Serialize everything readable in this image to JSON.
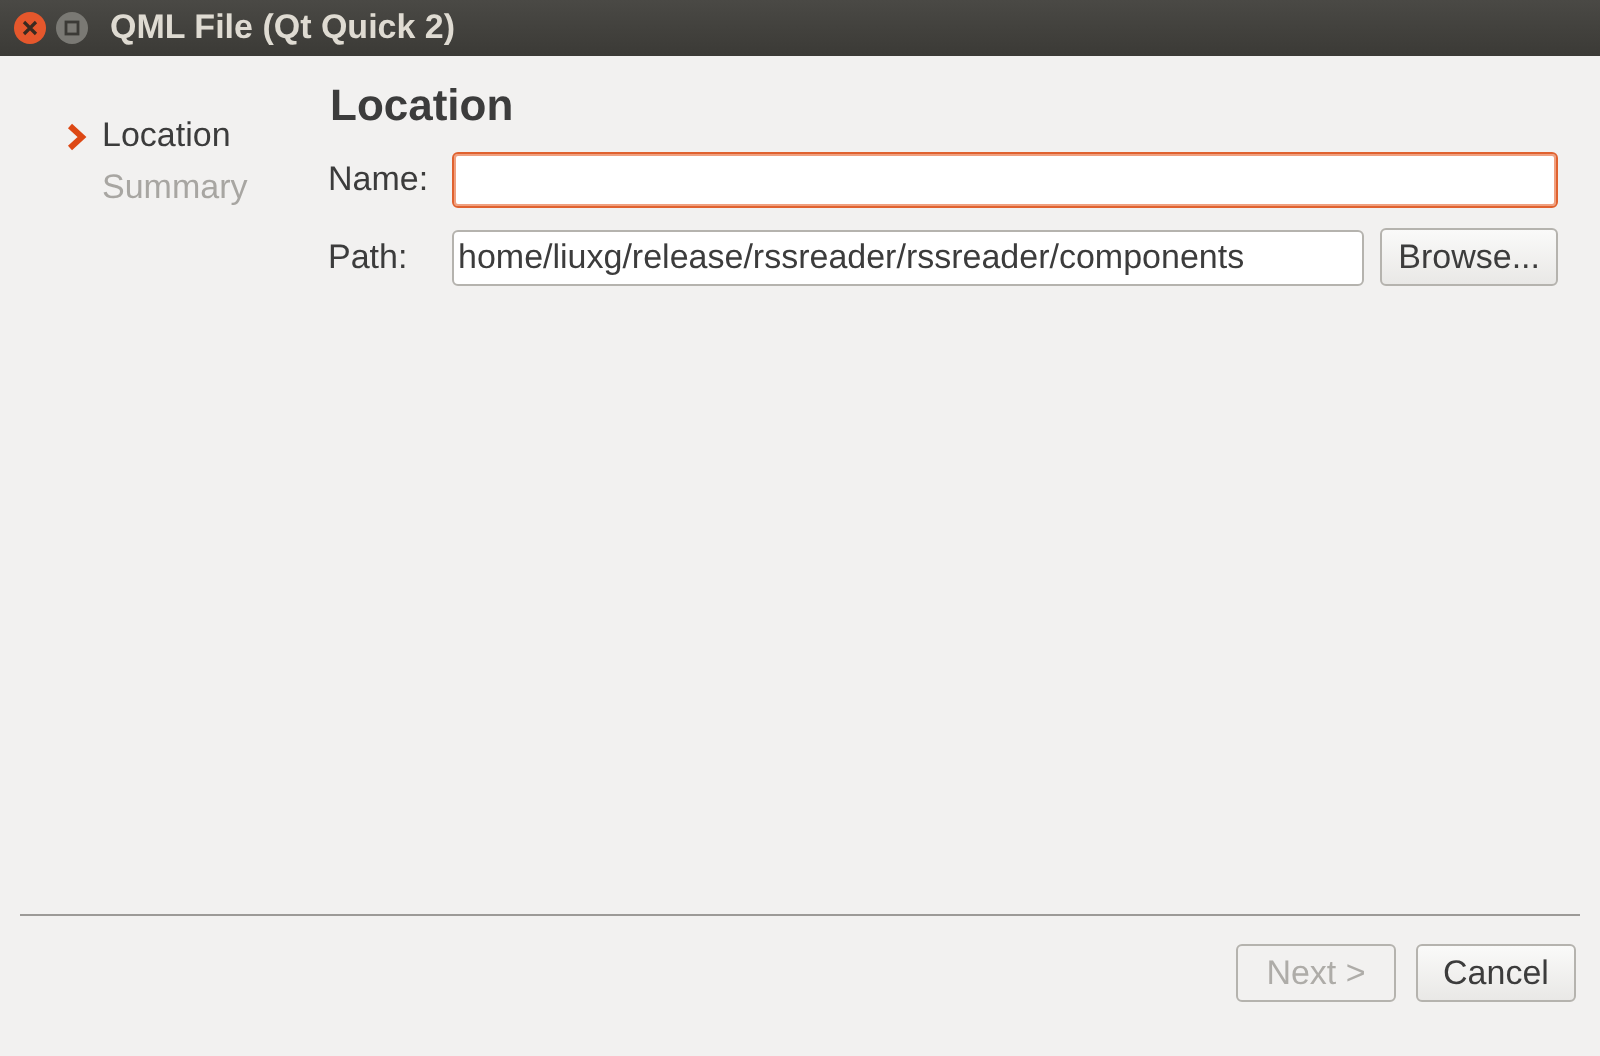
{
  "window": {
    "title": "QML File (Qt Quick 2)"
  },
  "steps": [
    {
      "label": "Location",
      "selected": true
    },
    {
      "label": "Summary",
      "selected": false
    }
  ],
  "page": {
    "heading": "Location",
    "fields": [
      {
        "label": "Name:",
        "focused": true
      },
      {
        "label": "Path:",
        "value": "home/liuxg/release/rssreader/rssreader/components",
        "focused": false,
        "button": "Browse..."
      }
    ]
  },
  "buttons": [
    {
      "label": "Next >",
      "disabled": true
    },
    {
      "label": "Cancel",
      "disabled": false
    }
  ]
}
